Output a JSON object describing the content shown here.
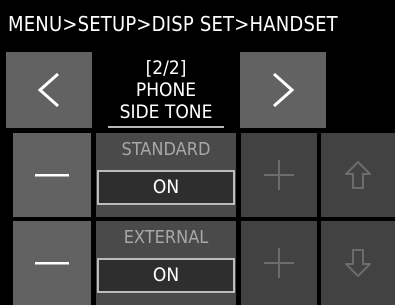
{
  "header": {
    "breadcrumb": "MENU>SETUP>DISP SET>HANDSET"
  },
  "pager": {
    "page": "[2/2]",
    "line1": "PHONE",
    "line2": "SIDE TONE",
    "prev_icon": "chevron-left-icon",
    "next_icon": "chevron-right-icon"
  },
  "settings": [
    {
      "label": "STANDARD",
      "value": "ON"
    },
    {
      "label": "EXTERNAL",
      "value": "ON"
    }
  ],
  "buttons": {
    "minus_icon": "minus-icon",
    "plus_icon": "plus-icon",
    "up_icon": "arrow-up-outline-icon",
    "down_icon": "arrow-down-outline-icon"
  },
  "colors": {
    "background": "#000000",
    "tile_active": "#626262",
    "tile_disabled": "#424242",
    "text": "#ffffff",
    "text_dim": "#a8a8a8"
  }
}
